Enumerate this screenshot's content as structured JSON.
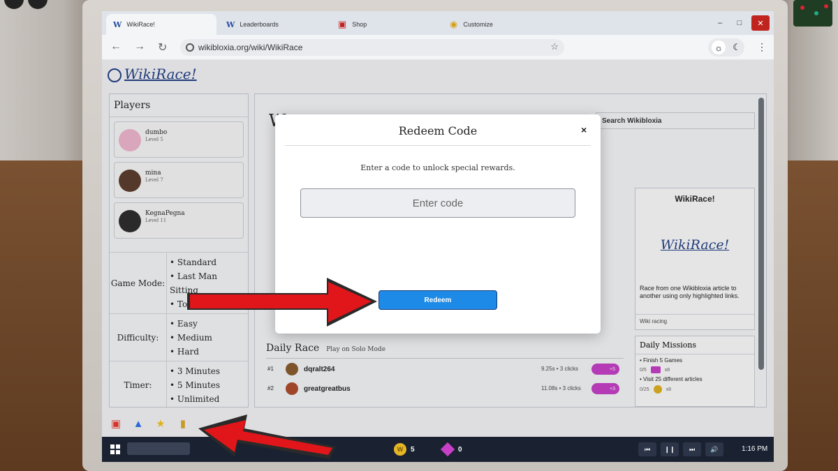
{
  "browser": {
    "tabs": [
      {
        "label": "WikiRace!",
        "icon": "wikibloxia-logo-icon",
        "active": true
      },
      {
        "label": "Leaderboards",
        "icon": "wikibloxia-logo-icon",
        "active": false
      },
      {
        "label": "Shop",
        "icon": "shop-basket-icon",
        "active": false
      },
      {
        "label": "Customize",
        "icon": "palette-icon",
        "active": false
      }
    ],
    "url": "wikibloxia.org/wiki/WikiRace",
    "tab_logo": "W"
  },
  "page": {
    "brand": "WikiRace!",
    "players_title": "Players",
    "players": [
      {
        "name": "dumbo",
        "level": "Level 5",
        "avatar_color": "#f2b8cf"
      },
      {
        "name": "mina",
        "level": "Level 7",
        "avatar_color": "#5a3c2a"
      },
      {
        "name": "KegnaPegna",
        "level": "Level 11",
        "avatar_color": "#2b2b2b"
      }
    ],
    "options": [
      {
        "label": "Game Mode:",
        "items": [
          "Standard",
          "Last Man Sitting",
          "Topic Tag"
        ]
      },
      {
        "label": "Difficulty:",
        "items": [
          "Easy",
          "Medium",
          "Hard"
        ]
      },
      {
        "label": "Timer:",
        "items": [
          "3 Minutes",
          "5 Minutes",
          "Unlimited"
        ]
      }
    ],
    "main_heading_initial": "W",
    "search_placeholder": "Search Wikibloxia",
    "infobox": {
      "title": "WikiRace!",
      "logo_text": "WikiRace!",
      "description": "Race from one Wikibloxia article to another using only highlighted links.",
      "tag": "Wiki racing"
    },
    "daily_missions": {
      "title": "Daily Missions",
      "items": [
        {
          "text": "• Finish 5 Games",
          "progress": "0/5",
          "reward": "x8"
        },
        {
          "text": "• Visit 25 different articles",
          "progress": "0/25",
          "reward": "x8"
        }
      ]
    },
    "daily_race": {
      "title": "Daily Race",
      "subtitle": "Play on Solo Mode",
      "rows": [
        {
          "rank": "#1",
          "name": "dqralt264",
          "time": "9.25s • 3 clicks",
          "reward": "+5"
        },
        {
          "rank": "#2",
          "name": "greatgreatbus",
          "time": "11.08s • 3 clicks",
          "reward": "+3"
        }
      ]
    }
  },
  "modal": {
    "title": "Redeem Code",
    "close": "×",
    "subtitle": "Enter a code to unlock special rewards.",
    "input_placeholder": "Enter code",
    "input_value": "",
    "button": "Redeem"
  },
  "quick_icons": [
    "gift-icon",
    "thumbs-up-icon",
    "star-icon",
    "ticket-icon"
  ],
  "taskbar": {
    "coins": "5",
    "gems": "0",
    "time": "1:16 PM"
  },
  "colors": {
    "accent_button": "#1c8ae6",
    "brand_blue": "#1f3e83",
    "gem_purple": "#c83ec8",
    "close_red": "#c0241f",
    "arrow_red": "#e0161a"
  }
}
